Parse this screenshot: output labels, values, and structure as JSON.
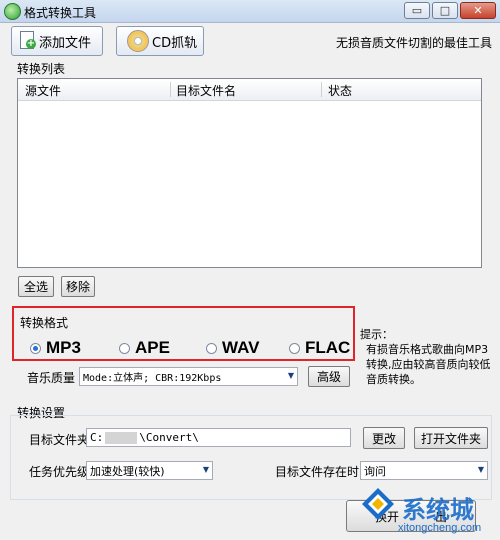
{
  "window": {
    "title": "格式转换工具",
    "minimize_glyph": "▭",
    "maximize_glyph": "□",
    "close_glyph": "✕"
  },
  "toolbar": {
    "add_file_label": "添加文件",
    "cd_rip_label": "CD抓轨",
    "slogan": "无损音质文件切割的最佳工具"
  },
  "list": {
    "section_label": "转换列表",
    "columns": [
      "源文件",
      "目标文件名",
      "状态"
    ]
  },
  "list_actions": {
    "select_all_label": "全选",
    "remove_label": "移除"
  },
  "format": {
    "section_label": "转换格式",
    "options": [
      {
        "label": "MP3",
        "selected": true
      },
      {
        "label": "APE",
        "selected": false
      },
      {
        "label": "WAV",
        "selected": false
      },
      {
        "label": "FLAC",
        "selected": false
      }
    ]
  },
  "tip": {
    "title": "提示：",
    "body": "有损音乐格式歌曲向MP3转换,应由较高音质向较低音质转换。"
  },
  "quality": {
    "label": "音乐质量",
    "value": "Mode:立体声; CBR:192Kbps",
    "advanced_label": "高级"
  },
  "settings": {
    "section_label": "转换设置",
    "target_folder_label": "目标文件夹",
    "target_folder_prefix": "C:",
    "target_folder_suffix": "\\Convert\\",
    "change_label": "更改",
    "open_folder_label": "打开文件夹",
    "priority_label": "任务优先级",
    "priority_value": "加速处理(较快)",
    "exists_label": "目标文件存在时",
    "exists_value": "询问"
  },
  "convert": {
    "label_left": "换开",
    "label_right": "出"
  },
  "watermark": {
    "text": "系统城",
    "url": "xitongcheng.com"
  },
  "colors": {
    "highlight_border": "#e0242c",
    "radio_selected": "#2b6fd1",
    "watermark": "#1a6dc9"
  }
}
